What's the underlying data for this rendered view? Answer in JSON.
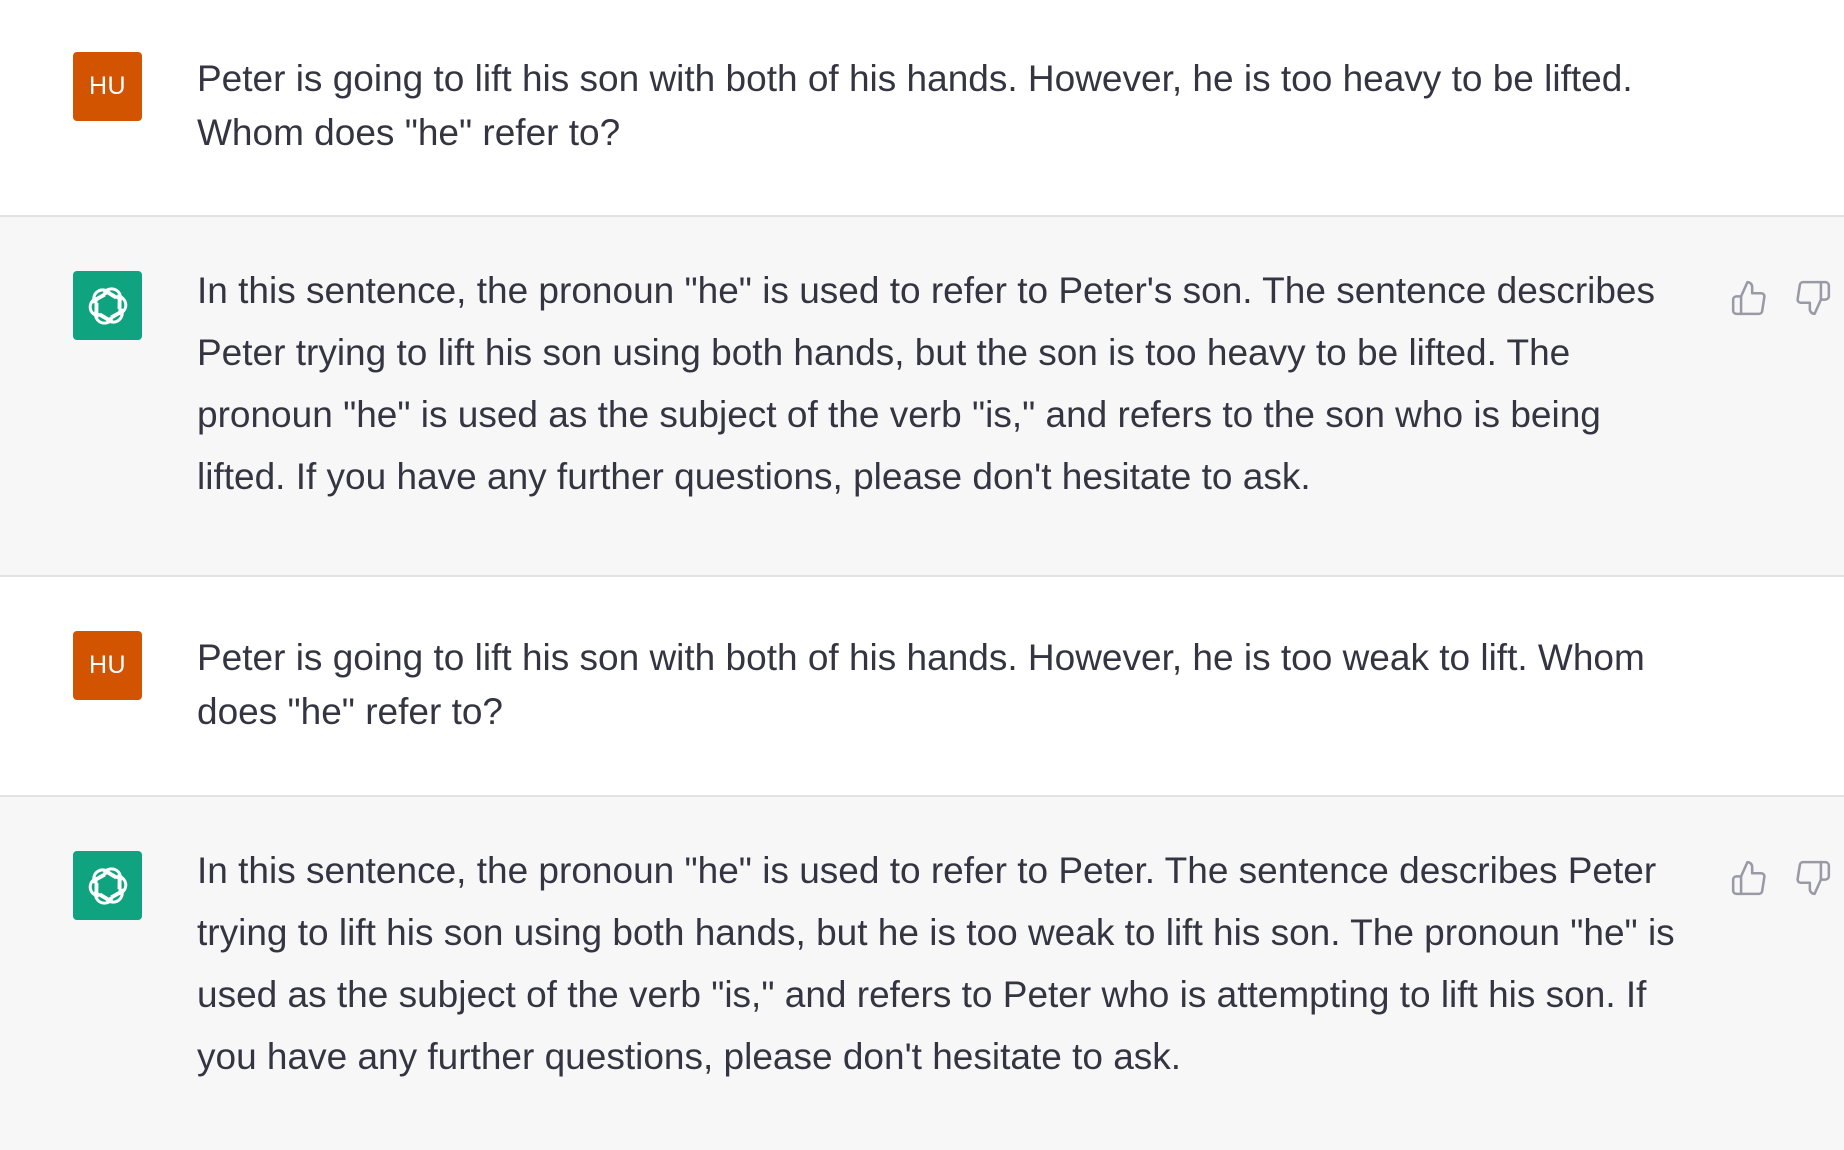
{
  "messages": [
    {
      "role": "user",
      "avatar_label": "HU",
      "text": "Peter is going to lift his son with both of his hands. However, he is too heavy to be lifted. Whom does \"he\" refer to?"
    },
    {
      "role": "assistant",
      "avatar_icon": "openai-logo-icon",
      "text": "In this sentence, the pronoun \"he\" is used to refer to Peter's son. The sentence describes Peter trying to lift his son using both hands, but the son is too heavy to be lifted. The pronoun \"he\" is used as the subject of the verb \"is,\" and refers to the son who is being lifted. If you have any further questions, please don't hesitate to ask."
    },
    {
      "role": "user",
      "avatar_label": "HU",
      "text": "Peter is going to lift his son with both of his hands. However, he is too weak to lift. Whom does \"he\" refer to?"
    },
    {
      "role": "assistant",
      "avatar_icon": "openai-logo-icon",
      "text": "In this sentence, the pronoun \"he\" is used to refer to Peter. The sentence describes Peter trying to lift his son using both hands, but he is too weak to lift his son. The pronoun \"he\" is used as the subject of the verb \"is,\" and refers to Peter who is attempting to lift his son. If you have any further questions, please don't hesitate to ask."
    }
  ],
  "feedback_icons": [
    "thumbs-up-icon",
    "thumbs-down-icon"
  ],
  "colors": {
    "user_avatar": "#d35400",
    "assistant_avatar": "#10a37f",
    "assistant_bg": "#f7f7f8",
    "text": "#343541",
    "divider": "#e3e3e6",
    "icon": "#9a9aa6"
  }
}
